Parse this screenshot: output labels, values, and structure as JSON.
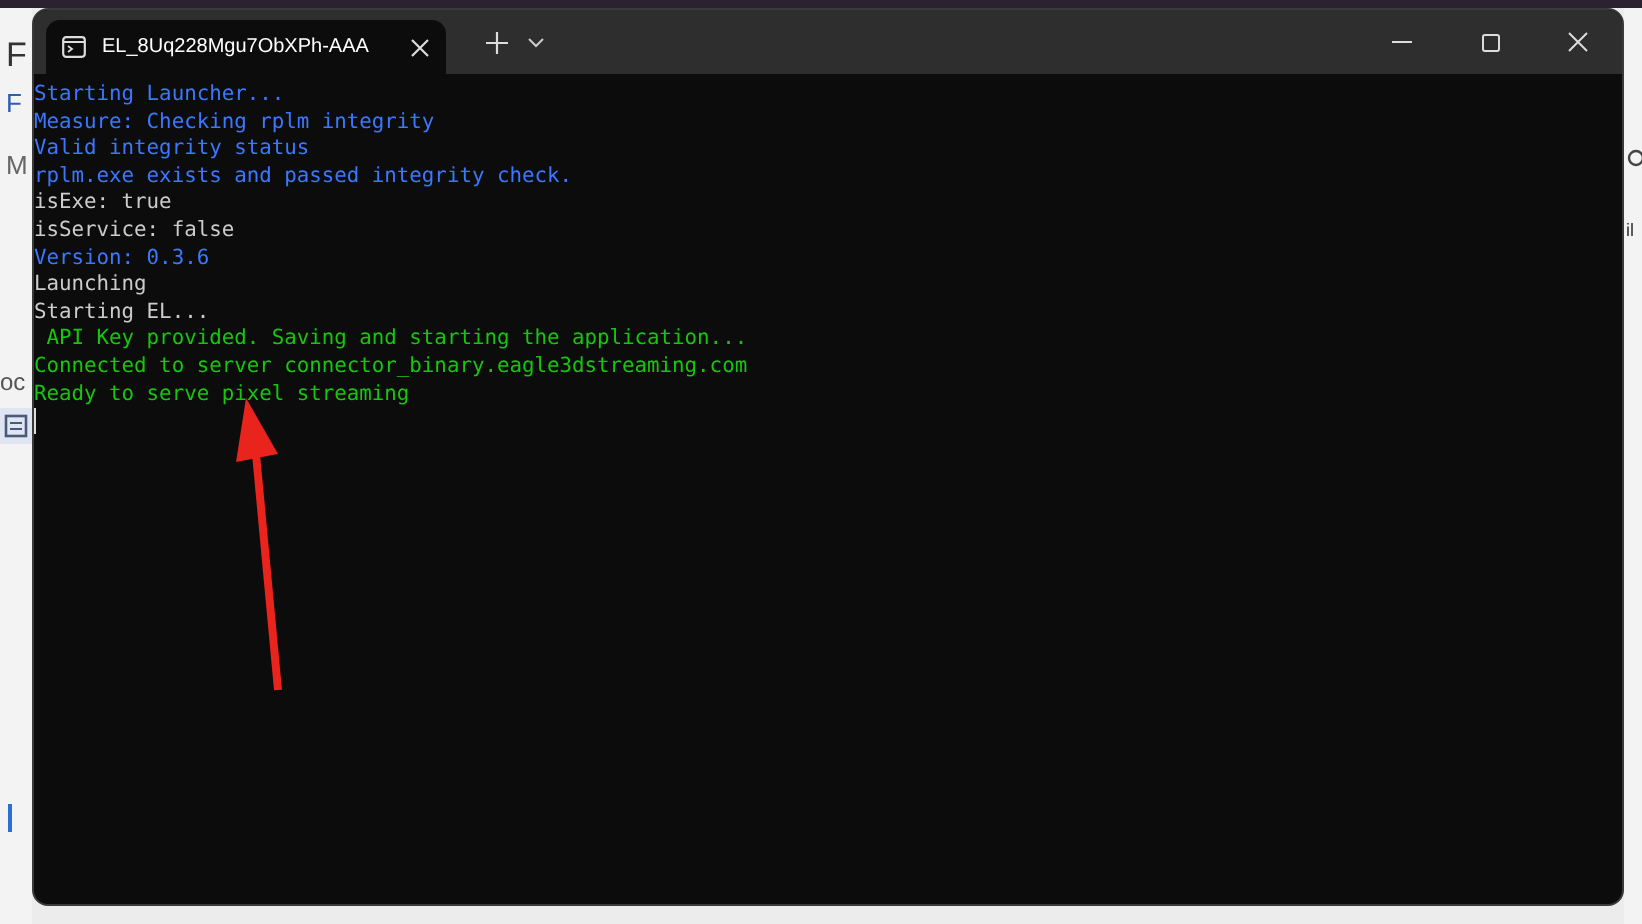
{
  "background_app": {
    "left_fragments": [
      "F",
      "F",
      "M",
      "oc"
    ],
    "right_fragments": [
      "il"
    ]
  },
  "window": {
    "tab": {
      "title": "EL_8Uq228Mgu7ObXPh-AAA",
      "selected": true
    },
    "lines": [
      {
        "text": "Starting Launcher...",
        "color": "#3b78ff"
      },
      {
        "text": "Measure: Checking rplm integrity",
        "color": "#3b78ff"
      },
      {
        "text": "Valid integrity status",
        "color": "#3b78ff"
      },
      {
        "text": "rplm.exe exists and passed integrity check.",
        "color": "#3b78ff"
      },
      {
        "text": "isExe: true",
        "color": "#cccccc"
      },
      {
        "text": "isService: false",
        "color": "#cccccc"
      },
      {
        "text": "Version: 0.3.6",
        "color": "#3b78ff"
      },
      {
        "text": "Launching",
        "color": "#cccccc"
      },
      {
        "text": "Starting EL...",
        "color": "#cccccc"
      },
      {
        "text": " API Key provided. Saving and starting the application...",
        "color": "#16c60c"
      },
      {
        "text": "Connected to server connector_binary.eagle3dstreaming.com",
        "color": "#16c60c"
      },
      {
        "text": "Ready to serve pixel streaming",
        "color": "#16c60c"
      }
    ]
  }
}
